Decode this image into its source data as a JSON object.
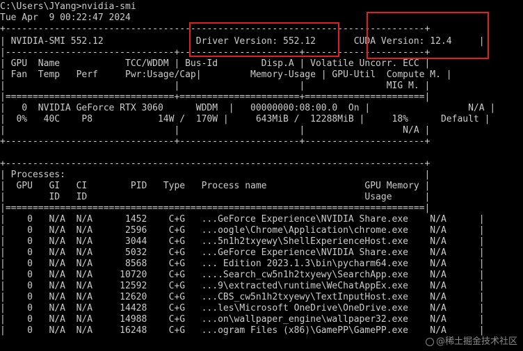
{
  "terminal": {
    "lines": [
      "C:\\Users\\JYang>nvidia-smi",
      "Tue Apr  9 00:22:47 2024",
      "+-----------------------------------------------------------------------------+",
      "| NVIDIA-SMI 552.12                 Driver Version: 552.12       CUDA Version: 12.4     |",
      "|-------------------------------+----------------------+----------------------+",
      "| GPU  Name            TCC/WDDM | Bus-Id        Disp.A | Volatile Uncorr. ECC |",
      "| Fan  Temp   Perf     Pwr:Usage/Cap|         Memory-Usage | GPU-Util  Compute M. |",
      "|                               |                      |               MIG M. |",
      "|===============================+======================+======================|",
      "|   0  NVIDIA GeForce RTX 3060      WDDM  |   00000000:08:00.0  On |                  N/A |",
      "|  0%   40C    P8            14W /  170W |     643MiB /  12288MiB |     18%      Default |",
      "|                               |                      |                  N/A |",
      "+-------------------------------+----------------------+----------------------+",
      "",
      "+-----------------------------------------------------------------------------+",
      "| Processes:                                                                  |",
      "|  GPU   GI   CI        PID   Type   Process name                  GPU Memory |",
      "|        ID   ID                                                   Usage      |",
      "|=============================================================================|",
      "|    0   N/A  N/A      1452    C+G   ...GeForce Experience\\NVIDIA Share.exe    N/A      |",
      "|    0   N/A  N/A      2596    C+G   ...oogle\\Chrome\\Application\\chrome.exe    N/A      |",
      "|    0   N/A  N/A      3044    C+G   ...5n1h2txyewy\\ShellExperienceHost.exe    N/A      |",
      "|    0   N/A  N/A      5032    C+G   ...GeForce Experience\\NVIDIA Share.exe    N/A      |",
      "|    0   N/A  N/A      8568    C+G   ... Edition 2023.1.3\\bin\\pycharm64.exe    N/A      |",
      "|    0   N/A  N/A     10720    C+G   ....Search_cw5n1h2txyewy\\SearchApp.exe    N/A      |",
      "|    0   N/A  N/A     12592    C+G   ...9\\extracted\\runtime\\WeChatAppEx.exe    N/A      |",
      "|    0   N/A  N/A     12620    C+G   ...CBS_cw5n1h2txyewy\\TextInputHost.exe    N/A      |",
      "|    0   N/A  N/A     14428    C+G   ...les\\Microsoft OneDrive\\OneDrive.exe    N/A      |",
      "|    0   N/A  N/A     14988    C+G   ...on\\wallpaper_engine\\wallpaper32.exe    N/A      |",
      "|    0   N/A  N/A     16248    C+G   ...ogram Files (x86)\\GamePP\\GamePP.exe    N/A      |"
    ]
  },
  "watermark": "@稀土掘金技术社区",
  "colors": {
    "background": "#000000",
    "text": "#cccccc",
    "highlight": "#e02020"
  }
}
